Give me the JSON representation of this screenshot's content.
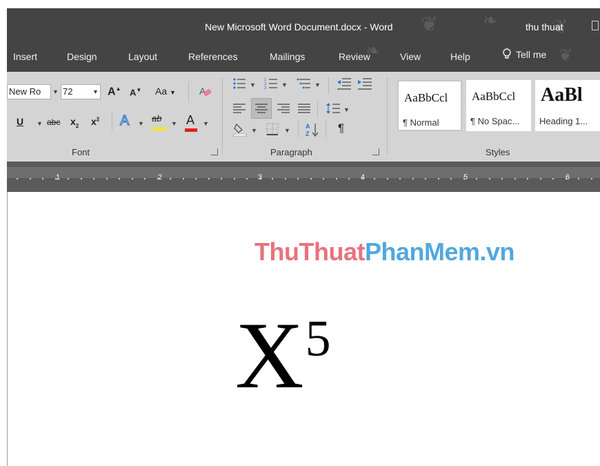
{
  "window": {
    "title": "New Microsoft Word Document.docx  -  Word",
    "user": "thu thuat"
  },
  "tabs": [
    "Insert",
    "Design",
    "Layout",
    "References",
    "Mailings",
    "Review",
    "View",
    "Help"
  ],
  "tell_me": "Tell me",
  "font_group": {
    "font_name": "New Ro",
    "font_size": "72",
    "grow_font": "A",
    "shrink_font": "A",
    "change_case": "Aa",
    "underline": "U",
    "strikethrough": "abc",
    "subscript": "x",
    "superscript": "x",
    "text_effects": "A",
    "highlight": "ab",
    "font_color": "A",
    "label": "Font"
  },
  "paragraph_group": {
    "label": "Paragraph",
    "pilcrow": "¶"
  },
  "styles_group": {
    "label": "Styles",
    "tiles": [
      {
        "preview": "AaBbCcl",
        "name": "¶ Normal"
      },
      {
        "preview": "AaBbCcl",
        "name": "¶ No Spac..."
      },
      {
        "preview": "AaBl",
        "name": "Heading 1..."
      }
    ]
  },
  "ruler": {
    "numbers": [
      "1",
      "2",
      "3",
      "4",
      "5",
      "6"
    ]
  },
  "document": {
    "watermark_part1": "ThuThuat",
    "watermark_part2": "PhanMem.vn",
    "base_text": "X",
    "superscript_text": "5"
  },
  "colors": {
    "title_bar": "#444444",
    "ribbon": "#d4d4d4",
    "watermark_pink": "#e8727f",
    "watermark_blue": "#51a8df",
    "highlight_yellow": "#f5e33a",
    "font_color_red": "#e02020"
  }
}
